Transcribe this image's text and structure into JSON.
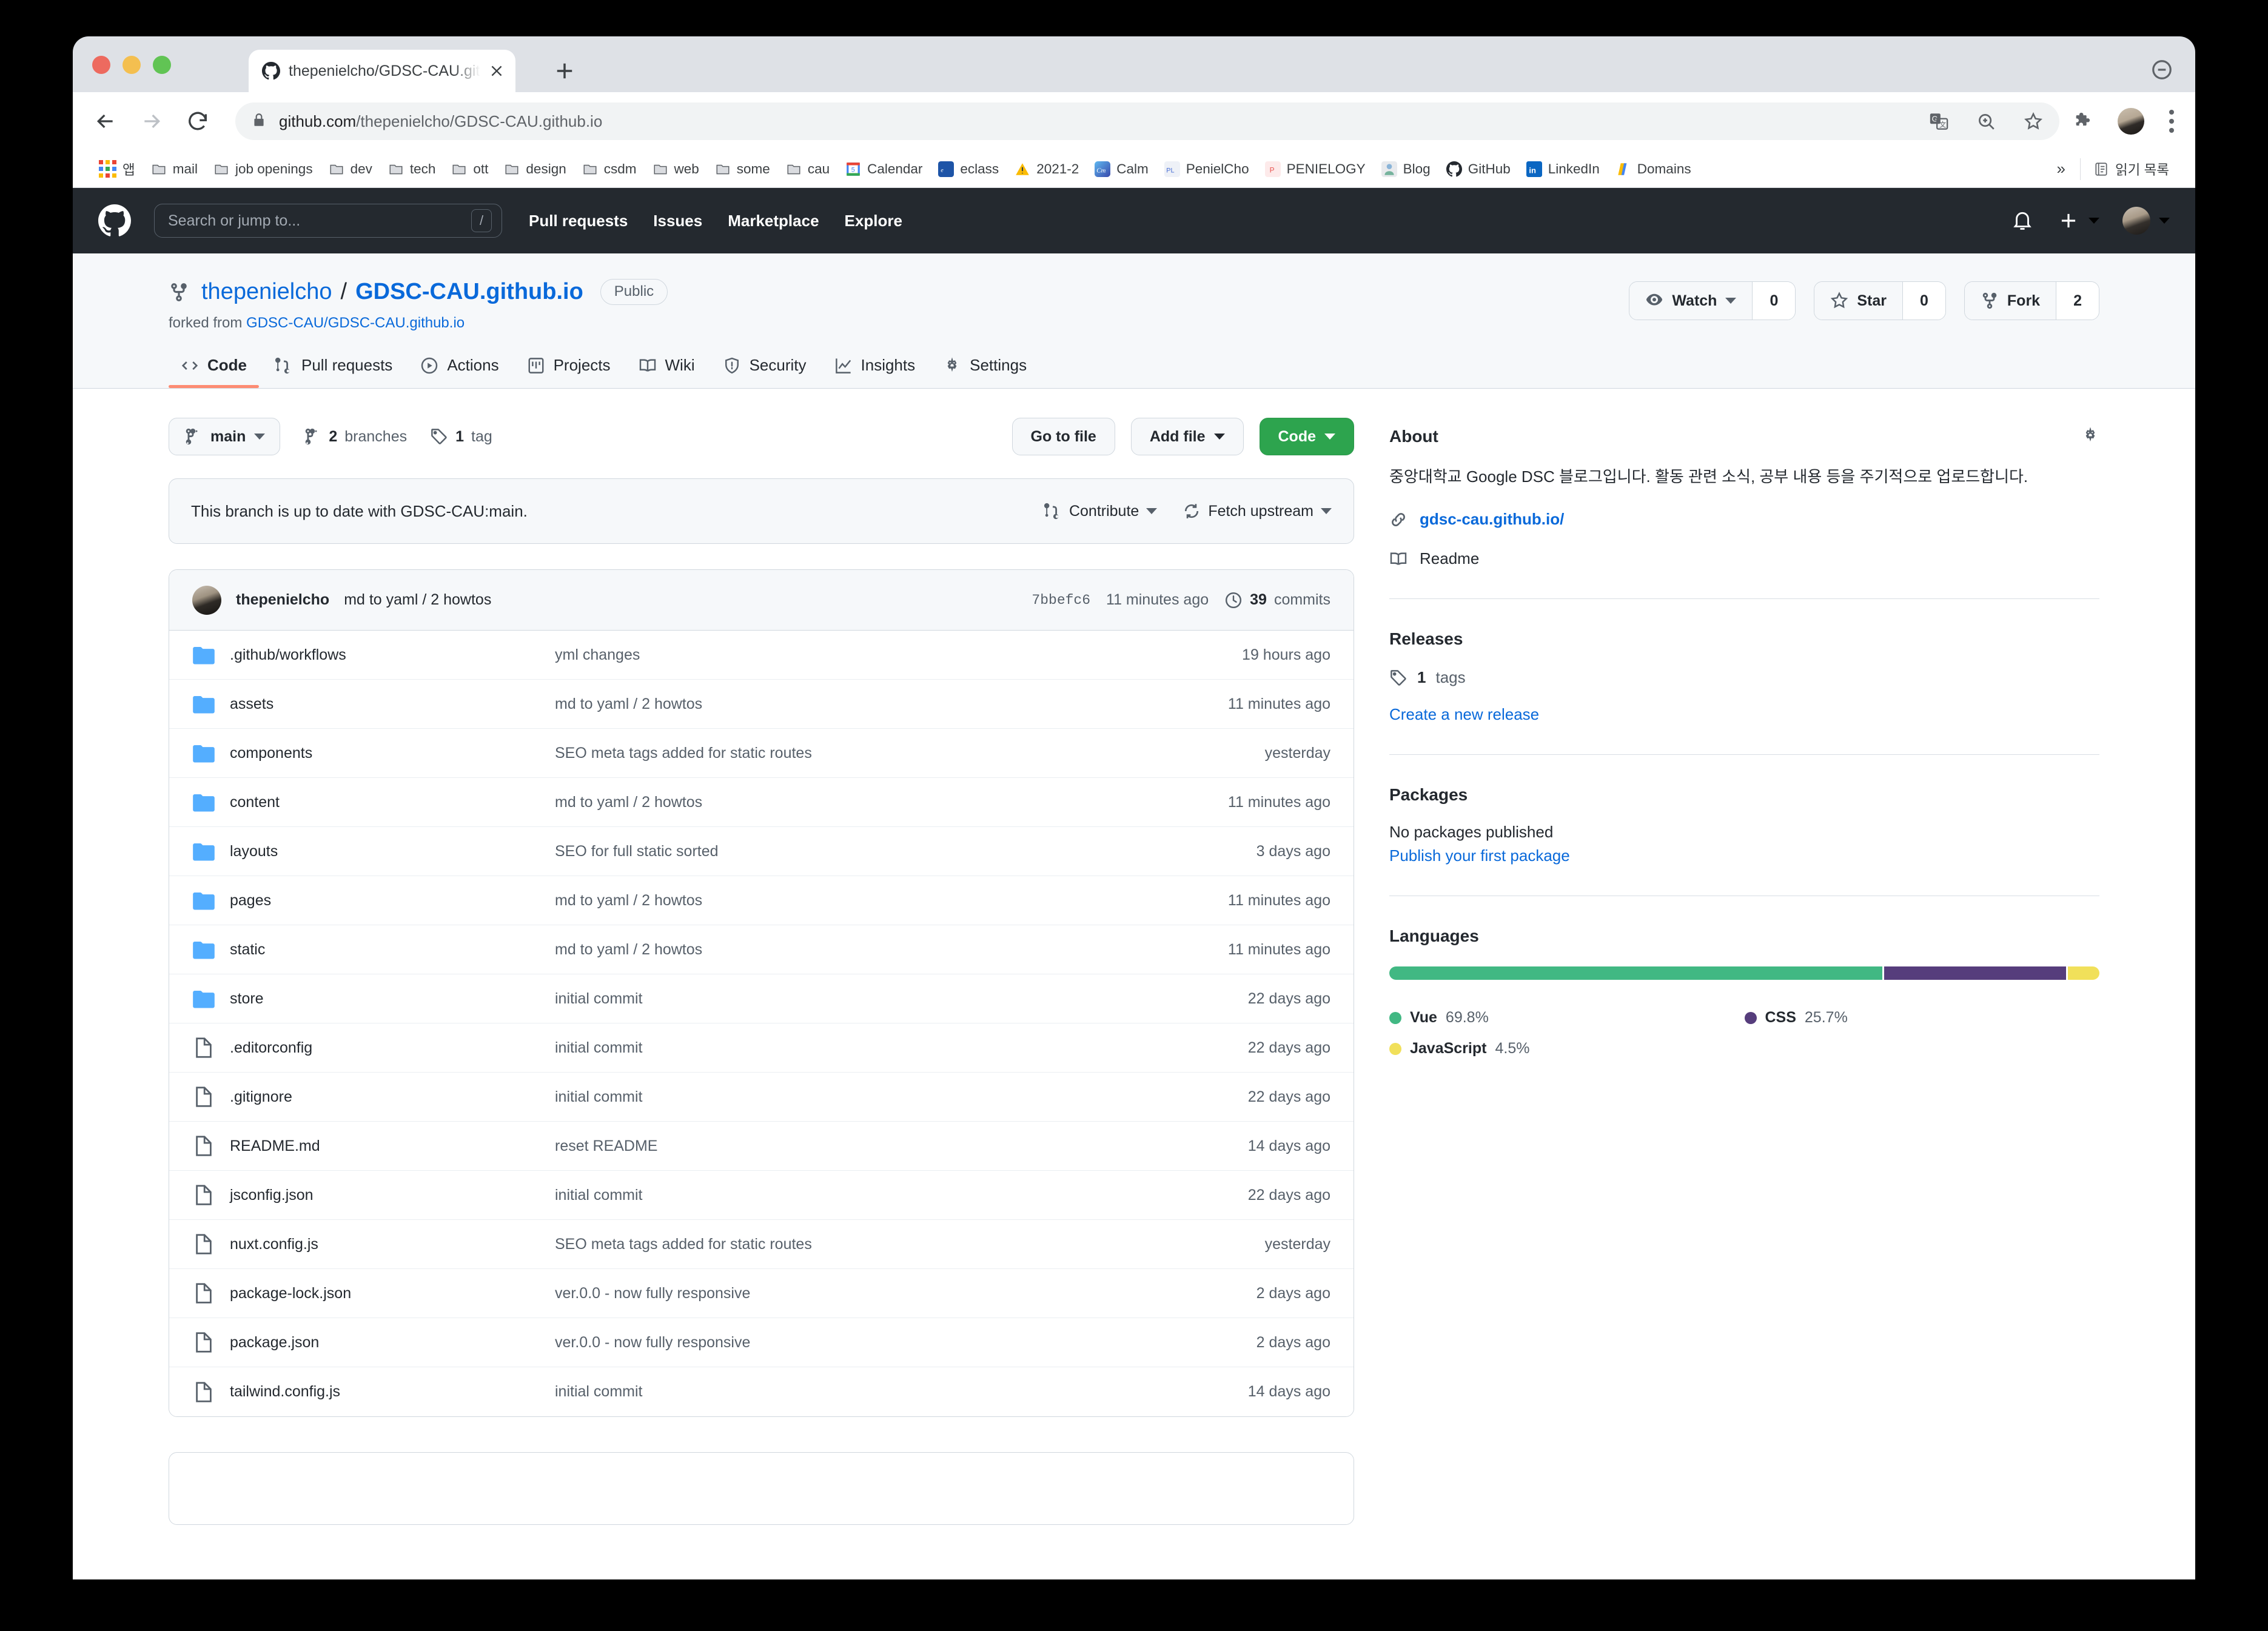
{
  "browser": {
    "tab": {
      "title": "thepenielcho/GDSC-CAU.githu",
      "favicon": "github-icon",
      "close": "close-icon"
    },
    "new_tab": "new-tab-icon",
    "url_secure": "github.com",
    "url_path": "/thepenielcho/GDSC-CAU.github.io",
    "bookmarks": [
      {
        "label": "mail",
        "icon": "folder-icon"
      },
      {
        "label": "job openings",
        "icon": "folder-icon"
      },
      {
        "label": "dev",
        "icon": "folder-icon"
      },
      {
        "label": "tech",
        "icon": "folder-icon"
      },
      {
        "label": "ott",
        "icon": "folder-icon"
      },
      {
        "label": "design",
        "icon": "folder-icon"
      },
      {
        "label": "csdm",
        "icon": "folder-icon"
      },
      {
        "label": "web",
        "icon": "folder-icon"
      },
      {
        "label": "some",
        "icon": "folder-icon"
      },
      {
        "label": "cau",
        "icon": "folder-icon"
      },
      {
        "label": "Calendar",
        "icon": "calendar-icon"
      },
      {
        "label": "eclass",
        "icon": "eclass-icon"
      },
      {
        "label": "2021-2",
        "icon": "warning-icon"
      },
      {
        "label": "Calm",
        "icon": "calm-icon"
      },
      {
        "label": "PenielCho",
        "icon": "penielcho-icon"
      },
      {
        "label": "PENIELOGY",
        "icon": "penielogy-icon"
      },
      {
        "label": "Blog",
        "icon": "blog-icon"
      },
      {
        "label": "GitHub",
        "icon": "github-icon"
      },
      {
        "label": "LinkedIn",
        "icon": "linkedin-icon"
      },
      {
        "label": "Domains",
        "icon": "domains-icon"
      }
    ],
    "apps_label": "앱",
    "overflow": "»",
    "reading_list": "읽기 목록"
  },
  "gh_header": {
    "search_placeholder": "Search or jump to...",
    "search_key": "/",
    "nav": [
      "Pull requests",
      "Issues",
      "Marketplace",
      "Explore"
    ]
  },
  "repo": {
    "owner": "thepenielcho",
    "separator": "/",
    "name": "GDSC-CAU.github.io",
    "visibility": "Public",
    "forked_from_label": "forked from",
    "forked_from": "GDSC-CAU/GDSC-CAU.github.io",
    "actions": [
      {
        "label": "Watch",
        "count": "0",
        "icon": "eye-icon",
        "caret": true
      },
      {
        "label": "Star",
        "count": "0",
        "icon": "star-icon",
        "caret": false
      },
      {
        "label": "Fork",
        "count": "2",
        "icon": "fork-icon",
        "caret": false
      }
    ],
    "tabs": [
      {
        "label": "Code",
        "icon": "code-icon",
        "active": true
      },
      {
        "label": "Pull requests",
        "icon": "pull-request-icon",
        "active": false
      },
      {
        "label": "Actions",
        "icon": "play-icon",
        "active": false
      },
      {
        "label": "Projects",
        "icon": "project-board-icon",
        "active": false
      },
      {
        "label": "Wiki",
        "icon": "book-icon",
        "active": false
      },
      {
        "label": "Security",
        "icon": "shield-icon",
        "active": false
      },
      {
        "label": "Insights",
        "icon": "graph-icon",
        "active": false
      },
      {
        "label": "Settings",
        "icon": "gear-icon",
        "active": false
      }
    ]
  },
  "file_toolbar": {
    "branch": "main",
    "branches_count": "2",
    "branches_label": "branches",
    "tags_count": "1",
    "tags_label": "tag",
    "go_to_file": "Go to file",
    "add_file": "Add file",
    "code": "Code"
  },
  "notice": {
    "text": "This branch is up to date with GDSC-CAU:main.",
    "contribute": "Contribute",
    "fetch_upstream": "Fetch upstream"
  },
  "commit": {
    "author": "thepenielcho",
    "message": "md to yaml / 2 howtos",
    "sha": "7bbefc6",
    "time": "11 minutes ago",
    "commits_count": "39",
    "commits_label": "commits"
  },
  "files": [
    {
      "type": "dir",
      "name": ".github/workflows",
      "message": "yml changes",
      "time": "19 hours ago"
    },
    {
      "type": "dir",
      "name": "assets",
      "message": "md to yaml / 2 howtos",
      "time": "11 minutes ago"
    },
    {
      "type": "dir",
      "name": "components",
      "message": "SEO meta tags added for static routes",
      "time": "yesterday"
    },
    {
      "type": "dir",
      "name": "content",
      "message": "md to yaml / 2 howtos",
      "time": "11 minutes ago"
    },
    {
      "type": "dir",
      "name": "layouts",
      "message": "SEO for full static sorted",
      "time": "3 days ago"
    },
    {
      "type": "dir",
      "name": "pages",
      "message": "md to yaml / 2 howtos",
      "time": "11 minutes ago"
    },
    {
      "type": "dir",
      "name": "static",
      "message": "md to yaml / 2 howtos",
      "time": "11 minutes ago"
    },
    {
      "type": "dir",
      "name": "store",
      "message": "initial commit",
      "time": "22 days ago"
    },
    {
      "type": "file",
      "name": ".editorconfig",
      "message": "initial commit",
      "time": "22 days ago"
    },
    {
      "type": "file",
      "name": ".gitignore",
      "message": "initial commit",
      "time": "22 days ago"
    },
    {
      "type": "file",
      "name": "README.md",
      "message": "reset README",
      "time": "14 days ago"
    },
    {
      "type": "file",
      "name": "jsconfig.json",
      "message": "initial commit",
      "time": "22 days ago"
    },
    {
      "type": "file",
      "name": "nuxt.config.js",
      "message": "SEO meta tags added for static routes",
      "time": "yesterday"
    },
    {
      "type": "file",
      "name": "package-lock.json",
      "message": "ver.0.0 - now fully responsive",
      "time": "2 days ago"
    },
    {
      "type": "file",
      "name": "package.json",
      "message": "ver.0.0 - now fully responsive",
      "time": "2 days ago"
    },
    {
      "type": "file",
      "name": "tailwind.config.js",
      "message": "initial commit",
      "time": "14 days ago"
    }
  ],
  "sidebar": {
    "about_title": "About",
    "about_desc": "중앙대학교 Google DSC 블로그입니다. 활동 관련 소식, 공부 내용 등을 주기적으로 업로드합니다.",
    "homepage": "gdsc-cau.github.io/",
    "readme": "Readme",
    "releases_title": "Releases",
    "releases_tags_count": "1",
    "releases_tags_label": "tags",
    "create_release": "Create a new release",
    "packages_title": "Packages",
    "no_packages": "No packages published",
    "publish_package": "Publish your first package",
    "languages_title": "Languages"
  },
  "chart_data": {
    "type": "bar",
    "title": "Languages",
    "categories": [
      "Vue",
      "CSS",
      "JavaScript"
    ],
    "values": [
      69.8,
      25.7,
      4.5
    ],
    "labels": [
      "69.8%",
      "25.7%",
      "4.5%"
    ],
    "colors": [
      "#41b883",
      "#563d7c",
      "#f1e05a"
    ],
    "xlabel": "",
    "ylabel": "",
    "ylim": [
      0,
      100
    ]
  },
  "colors": {
    "accent_blue": "#0969da",
    "green_button": "#2da44e",
    "header_dark": "#24292f",
    "vue": "#41b883",
    "css": "#563d7c",
    "javascript": "#f1e05a"
  }
}
